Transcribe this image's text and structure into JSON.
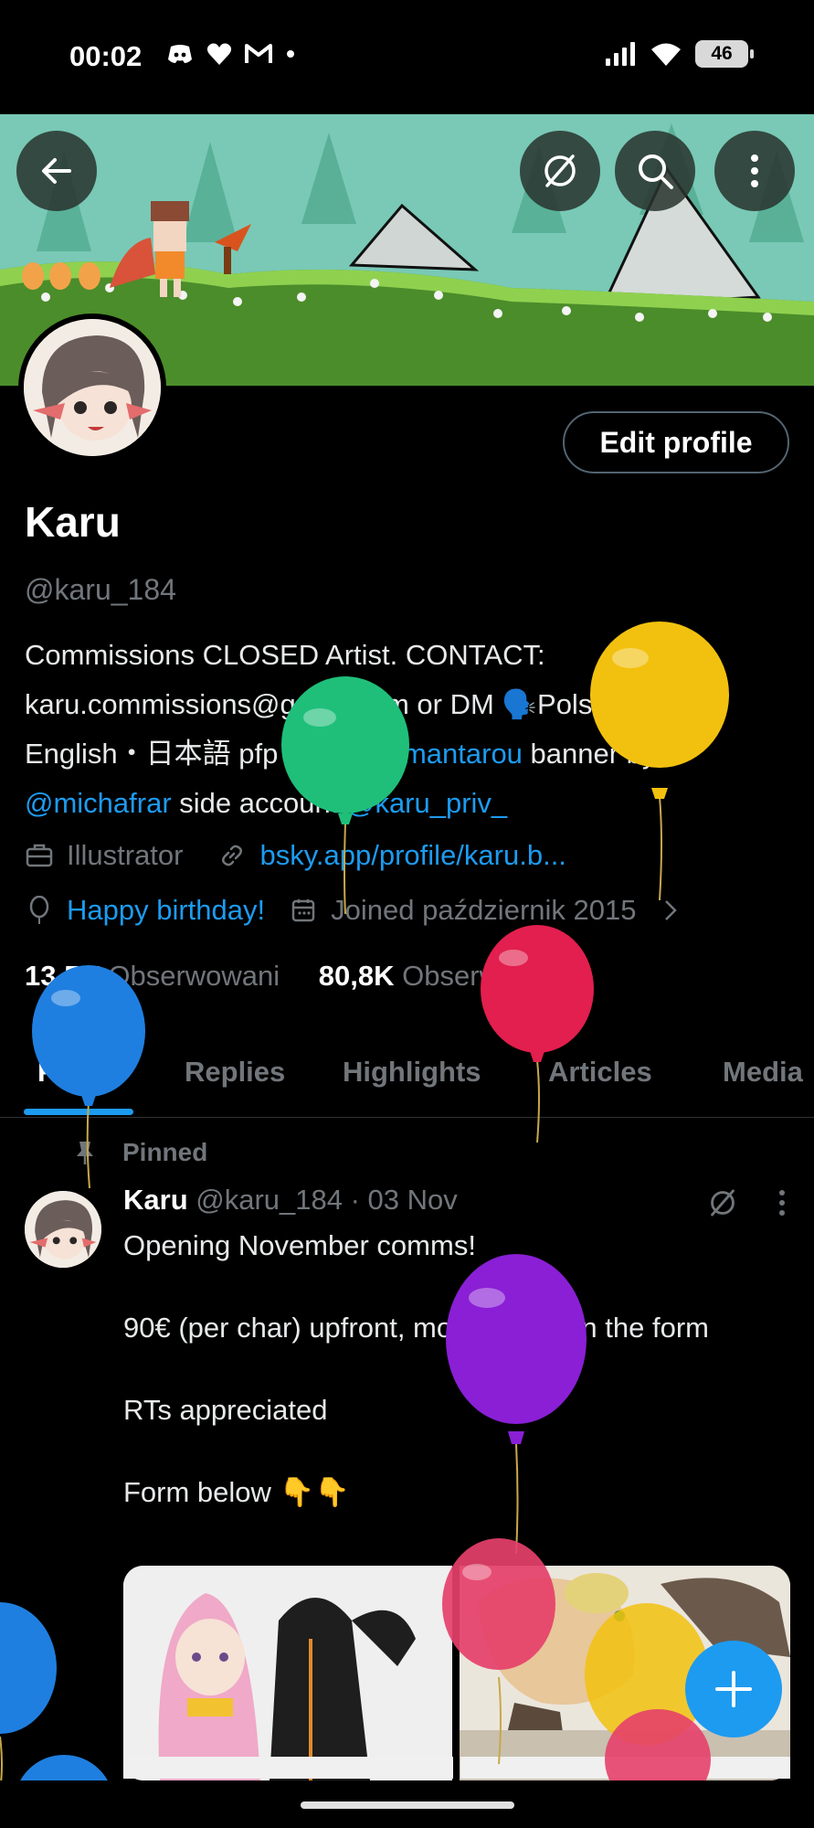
{
  "status_bar": {
    "time": "00:02",
    "battery": "46",
    "left_icons": [
      "discord-icon",
      "heart-icon",
      "gmail-icon",
      "dot-icon"
    ],
    "right_icons": [
      "signal-icon",
      "wifi-icon",
      "battery-icon"
    ]
  },
  "banner": {
    "buttons": [
      "back-arrow-icon",
      "grok-icon",
      "search-icon",
      "more-vertical-icon"
    ]
  },
  "profile": {
    "edit_button": "Edit profile",
    "name": "Karu",
    "handle": "@karu_184",
    "bio_line1": "Commissions CLOSED Artist.  CONTACT:",
    "bio_line2_a": "karu.commissions@gmail.com or DM ",
    "bio_line2_emoji": "🗣️",
    "bio_line2_b": "Polski・",
    "bio_line3_a": "English・日本語  pfp by ",
    "bio_line3_link": "@kokimantarou",
    "bio_line3_b": " banner by",
    "bio_line4_link1": "@michafrar",
    "bio_line4_mid": " side account ",
    "bio_line4_link2": "@karu_priv_",
    "occupation": "Illustrator",
    "website": "bsky.app/profile/karu.b...",
    "birthday": "Happy birthday!",
    "joined": "Joined październik 2015",
    "following_count": "13,5K",
    "following_label": "Obserwowani",
    "followers_count": "80,8K",
    "followers_label": "Obserwujący"
  },
  "tabs": [
    {
      "label": "Posts",
      "active": true
    },
    {
      "label": "Replies",
      "active": false
    },
    {
      "label": "Highlights",
      "active": false
    },
    {
      "label": "Articles",
      "active": false
    },
    {
      "label": "Media",
      "active": false
    }
  ],
  "pinned_post": {
    "pinned_label": "Pinned",
    "author": "Karu",
    "handle_date": "@karu_184 · 03 Nov",
    "line1": "Opening November comms!",
    "line2": "90€ (per char) upfront, more details in the form",
    "line3": "RTs appreciated",
    "line4": "Form below 👇👇"
  },
  "fab_icon": "plus-icon",
  "colors": {
    "accent": "#1d9bf0",
    "secondary_text": "#71767b",
    "background": "#000000"
  }
}
